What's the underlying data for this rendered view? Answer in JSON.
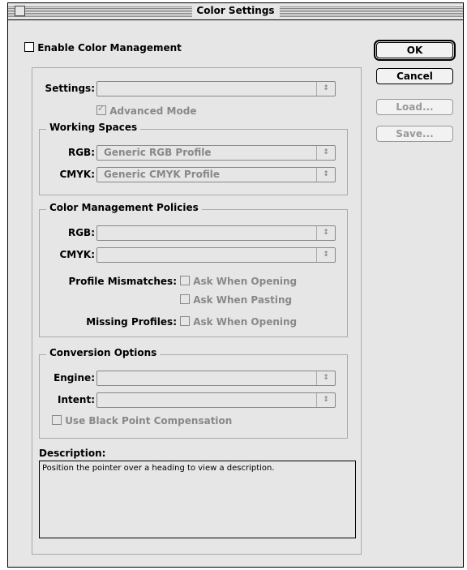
{
  "window": {
    "title": "Color Settings"
  },
  "enable": {
    "label": "Enable Color Management"
  },
  "settings": {
    "label": "Settings:",
    "value": ""
  },
  "advanced": {
    "label": "Advanced Mode",
    "checked": true
  },
  "working_spaces": {
    "heading": "Working Spaces",
    "rgb_label": "RGB:",
    "rgb_value": "Generic RGB Profile",
    "cmyk_label": "CMYK:",
    "cmyk_value": "Generic CMYK Profile"
  },
  "policies": {
    "heading": "Color Management Policies",
    "rgb_label": "RGB:",
    "rgb_value": "",
    "cmyk_label": "CMYK:",
    "cmyk_value": "",
    "mismatch_label": "Profile Mismatches:",
    "ask_opening": "Ask When Opening",
    "ask_pasting": "Ask When Pasting",
    "missing_label": "Missing Profiles:",
    "missing_opening": "Ask When Opening"
  },
  "conversion": {
    "heading": "Conversion Options",
    "engine_label": "Engine:",
    "engine_value": "",
    "intent_label": "Intent:",
    "intent_value": "",
    "bpc_label": "Use Black Point Compensation"
  },
  "description": {
    "heading": "Description:",
    "text": "Position the pointer over a heading to view a description."
  },
  "buttons": {
    "ok": "OK",
    "cancel": "Cancel",
    "load": "Load...",
    "save": "Save..."
  },
  "icons": {
    "popup_arrows": "↕",
    "check": "✓"
  },
  "colors": {
    "window_bg": "#e6e6e6",
    "disabled_text": "#888888"
  }
}
